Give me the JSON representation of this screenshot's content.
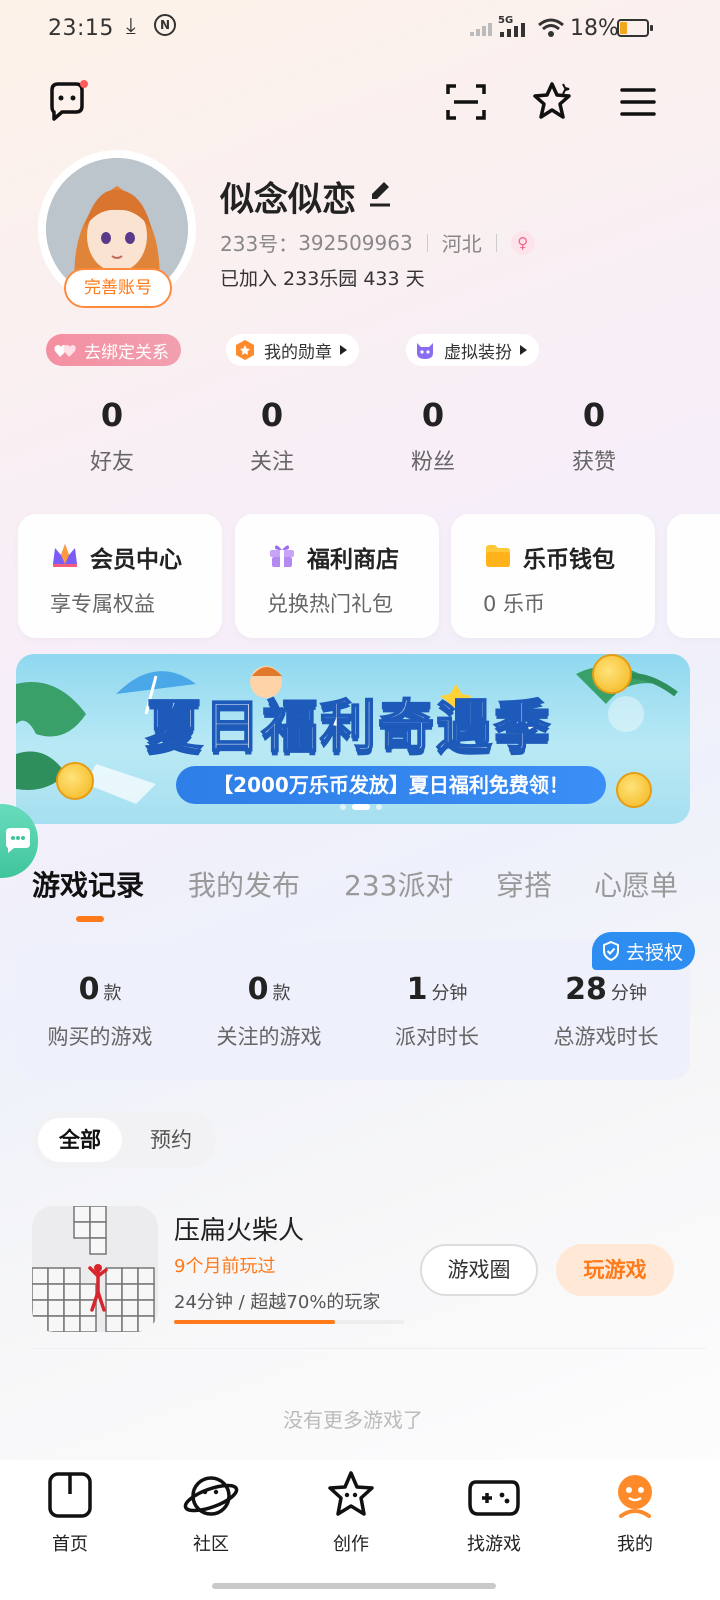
{
  "status_bar": {
    "time": "23:15",
    "network": "5G",
    "battery": "18%"
  },
  "profile": {
    "nickname": "似念似恋",
    "id_label": "233号：",
    "id_value": "392509963",
    "region": "河北",
    "joined": "已加入 233乐园 433 天",
    "complete_button": "完善账号"
  },
  "chips": [
    {
      "label": "去绑定关系"
    },
    {
      "label": "我的勋章"
    },
    {
      "label": "虚拟装扮"
    }
  ],
  "stats": [
    {
      "value": "0",
      "label": "好友"
    },
    {
      "value": "0",
      "label": "关注"
    },
    {
      "value": "0",
      "label": "粉丝"
    },
    {
      "value": "0",
      "label": "获赞"
    }
  ],
  "cards": [
    {
      "title": "会员中心",
      "subtitle": "享专属权益"
    },
    {
      "title": "福利商店",
      "subtitle": "兑换热门礼包"
    },
    {
      "title": "乐币钱包",
      "subtitle": "0 乐币"
    }
  ],
  "banner": {
    "headline": "夏日福利奇遇季",
    "subline": "【2000万乐币发放】夏日福利免费领！"
  },
  "tabs": [
    {
      "label": "游戏记录"
    },
    {
      "label": "我的发布"
    },
    {
      "label": "233派对"
    },
    {
      "label": "穿搭"
    },
    {
      "label": "心愿单"
    }
  ],
  "authorize": {
    "label": "去授权"
  },
  "game_stats": [
    {
      "value": "0",
      "unit": "款",
      "label": "购买的游戏"
    },
    {
      "value": "0",
      "unit": "款",
      "label": "关注的游戏"
    },
    {
      "value": "1",
      "unit": "分钟",
      "label": "派对时长"
    },
    {
      "value": "28",
      "unit": "分钟",
      "label": "总游戏时长"
    }
  ],
  "filter": {
    "all": "全部",
    "reserve": "预约"
  },
  "games": [
    {
      "name": "压扁火柴人",
      "last_played": "9个月前玩过",
      "play_info": "24分钟 / 超越70%的玩家",
      "progress": 0.7,
      "circle_button": "游戏圈",
      "play_button": "玩游戏"
    }
  ],
  "no_more": "没有更多游戏了",
  "bottom_nav": [
    {
      "label": "首页",
      "icon": "home-icon"
    },
    {
      "label": "社区",
      "icon": "planet-icon"
    },
    {
      "label": "创作",
      "icon": "star-face-icon"
    },
    {
      "label": "找游戏",
      "icon": "gamepad-icon"
    },
    {
      "label": "我的",
      "icon": "mascot-icon"
    }
  ],
  "colors": {
    "accent": "#ff7a1a",
    "auth_blue": "#2e8df0",
    "panel_bg": "#eef1fb"
  }
}
